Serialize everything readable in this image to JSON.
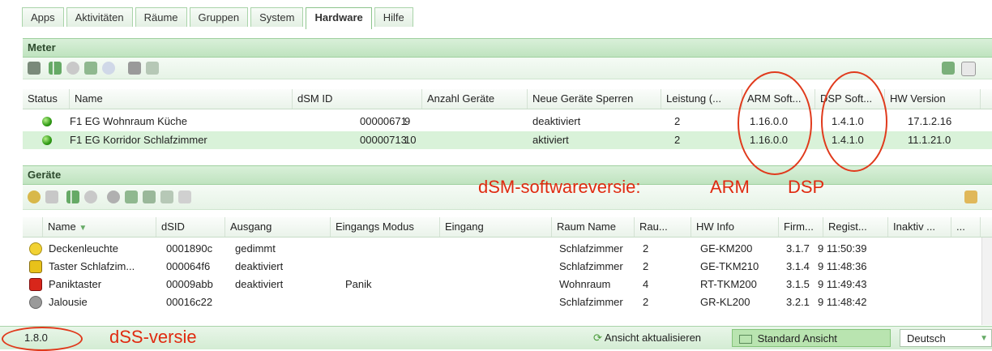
{
  "tabs": [
    "Apps",
    "Aktivitäten",
    "Räume",
    "Gruppen",
    "System",
    "Hardware",
    "Hilfe"
  ],
  "active_tab": "Hardware",
  "meter": {
    "title": "Meter",
    "columns": [
      "Status",
      "Name",
      "dSM ID",
      "Anzahl Geräte",
      "Neue Geräte Sperren",
      "Leistung (...",
      "ARM Soft...",
      "DSP Soft...",
      "HW Version"
    ],
    "rows": [
      {
        "name": "F1 EG Wohnraum Küche",
        "dsm_id": "00000671",
        "count": "9",
        "lock": "deaktiviert",
        "power": "2",
        "arm": "1.16.0.0",
        "dsp": "1.4.1.0",
        "hw": "17.1.2.16"
      },
      {
        "name": "F1 EG Korridor Schlafzimmer",
        "dsm_id": "00000713",
        "count": "10",
        "lock": "aktiviert",
        "power": "2",
        "arm": "1.16.0.0",
        "dsp": "1.4.1.0",
        "hw": "11.1.21.0"
      }
    ]
  },
  "devices": {
    "title": "Geräte",
    "columns": [
      "Name",
      "dSID",
      "Ausgang",
      "Eingangs Modus",
      "Eingang",
      "Raum Name",
      "Rau...",
      "HW Info",
      "Firm...",
      "Regist...",
      "Inaktiv ...",
      "..."
    ],
    "rows": [
      {
        "icon": "yellow-light-icon",
        "name": "Deckenleuchte",
        "dsid": "0001890c",
        "out": "gedimmt",
        "mode": "",
        "input": "",
        "room": "Schlafzimmer",
        "roomno": "2",
        "hw": "GE-KM200",
        "fw": "3.1.7",
        "reg": "9 11:50:39"
      },
      {
        "icon": "yellow-button-icon",
        "name": "Taster Schlafzim...",
        "dsid": "000064f6",
        "out": "deaktiviert",
        "mode": "",
        "input": "",
        "room": "Schlafzimmer",
        "roomno": "2",
        "hw": "GE-TKM210",
        "fw": "3.1.4",
        "reg": "9 11:48:36"
      },
      {
        "icon": "red-button-icon",
        "name": "Paniktaster",
        "dsid": "00009abb",
        "out": "deaktiviert",
        "mode": "Panik",
        "input": "",
        "room": "Wohnraum",
        "roomno": "4",
        "hw": "RT-TKM200",
        "fw": "3.1.5",
        "reg": "9 11:49:43"
      },
      {
        "icon": "grey-shade-icon",
        "name": "Jalousie",
        "dsid": "00016c22",
        "out": "",
        "mode": "",
        "input": "",
        "room": "Schlafzimmer",
        "roomno": "2",
        "hw": "GR-KL200",
        "fw": "3.2.1",
        "reg": "9 11:48:42"
      }
    ]
  },
  "annotations": {
    "dsm_label": "dSM-softwareversie:",
    "arm": "ARM",
    "dsp": "DSP",
    "dss_label": "dSS-versie"
  },
  "statusbar": {
    "version": "1.8.0",
    "refresh": "Ansicht aktualisieren",
    "standard": "Standard Ansicht",
    "language": "Deutsch"
  },
  "colors": {
    "accent_green": "#bfe3bf",
    "annotation_red": "#e02a10"
  }
}
